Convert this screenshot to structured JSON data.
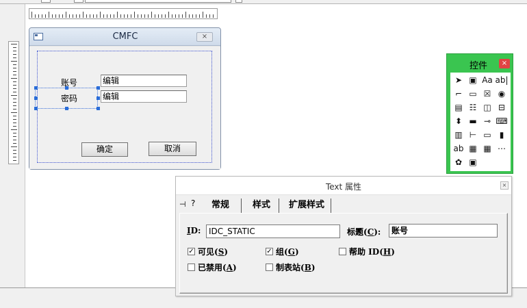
{
  "dialog": {
    "title": "CMFC",
    "close_glyph": "⨯",
    "label_account": "账号",
    "label_password": "密码",
    "edit_account": "编辑",
    "edit_password": "编辑",
    "ok_button": "确定",
    "cancel_button": "取消"
  },
  "toolbox": {
    "title": "控件",
    "close_glyph": "×",
    "tools": [
      {
        "name": "pointer-tool",
        "glyph": "➤"
      },
      {
        "name": "picture-tool",
        "glyph": "▣"
      },
      {
        "name": "static-text-tool",
        "glyph": "Aa"
      },
      {
        "name": "edit-box-tool",
        "glyph": "ab|"
      },
      {
        "name": "group-box-tool",
        "glyph": "⌐"
      },
      {
        "name": "button-tool",
        "glyph": "▭"
      },
      {
        "name": "check-box-tool",
        "glyph": "☒"
      },
      {
        "name": "radio-button-tool",
        "glyph": "◉"
      },
      {
        "name": "combo-box-tool",
        "glyph": "▤"
      },
      {
        "name": "list-box-tool",
        "glyph": "☷"
      },
      {
        "name": "horizontal-scrollbar-tool",
        "glyph": "◫"
      },
      {
        "name": "vertical-scrollbar-tool",
        "glyph": "⊟"
      },
      {
        "name": "spin-tool",
        "glyph": "⬍"
      },
      {
        "name": "progress-tool",
        "glyph": "▬"
      },
      {
        "name": "slider-tool",
        "glyph": "⊸"
      },
      {
        "name": "hotkey-tool",
        "glyph": "⌨"
      },
      {
        "name": "list-control-tool",
        "glyph": "▥"
      },
      {
        "name": "tree-control-tool",
        "glyph": "⊢"
      },
      {
        "name": "tab-control-tool",
        "glyph": "▭"
      },
      {
        "name": "animation-tool",
        "glyph": "▮"
      },
      {
        "name": "rich-edit-tool",
        "glyph": "ab"
      },
      {
        "name": "date-time-tool",
        "glyph": "▦"
      },
      {
        "name": "month-calendar-tool",
        "glyph": "▦"
      },
      {
        "name": "ip-address-tool",
        "glyph": "⋯"
      },
      {
        "name": "custom-control-tool",
        "glyph": "✿"
      },
      {
        "name": "extended-combo-tool",
        "glyph": "▣"
      }
    ]
  },
  "properties": {
    "title": "Text 属性",
    "close_glyph": "×",
    "pin_glyph": "⊣",
    "help_glyph": "?",
    "tabs": [
      "常规",
      "样式",
      "扩展样式"
    ],
    "id_label_letter": "I",
    "id_label_rest": "D:",
    "id_value": "IDC_STATIC",
    "combo_arrow": "▼",
    "caption_label": "标题(",
    "caption_key": "C",
    "caption_label_end": "):",
    "caption_value": "账号",
    "visible_label": "可见(",
    "visible_key": "S",
    "group_label": "组(",
    "group_key": "G",
    "helpid_label": "帮助 ID(",
    "helpid_key": "H",
    "disabled_label": "已禁用(",
    "disabled_key": "A",
    "tabstop_label": "制表站(",
    "tabstop_key": "B",
    "close_paren": ")",
    "check_mark": "✓"
  }
}
